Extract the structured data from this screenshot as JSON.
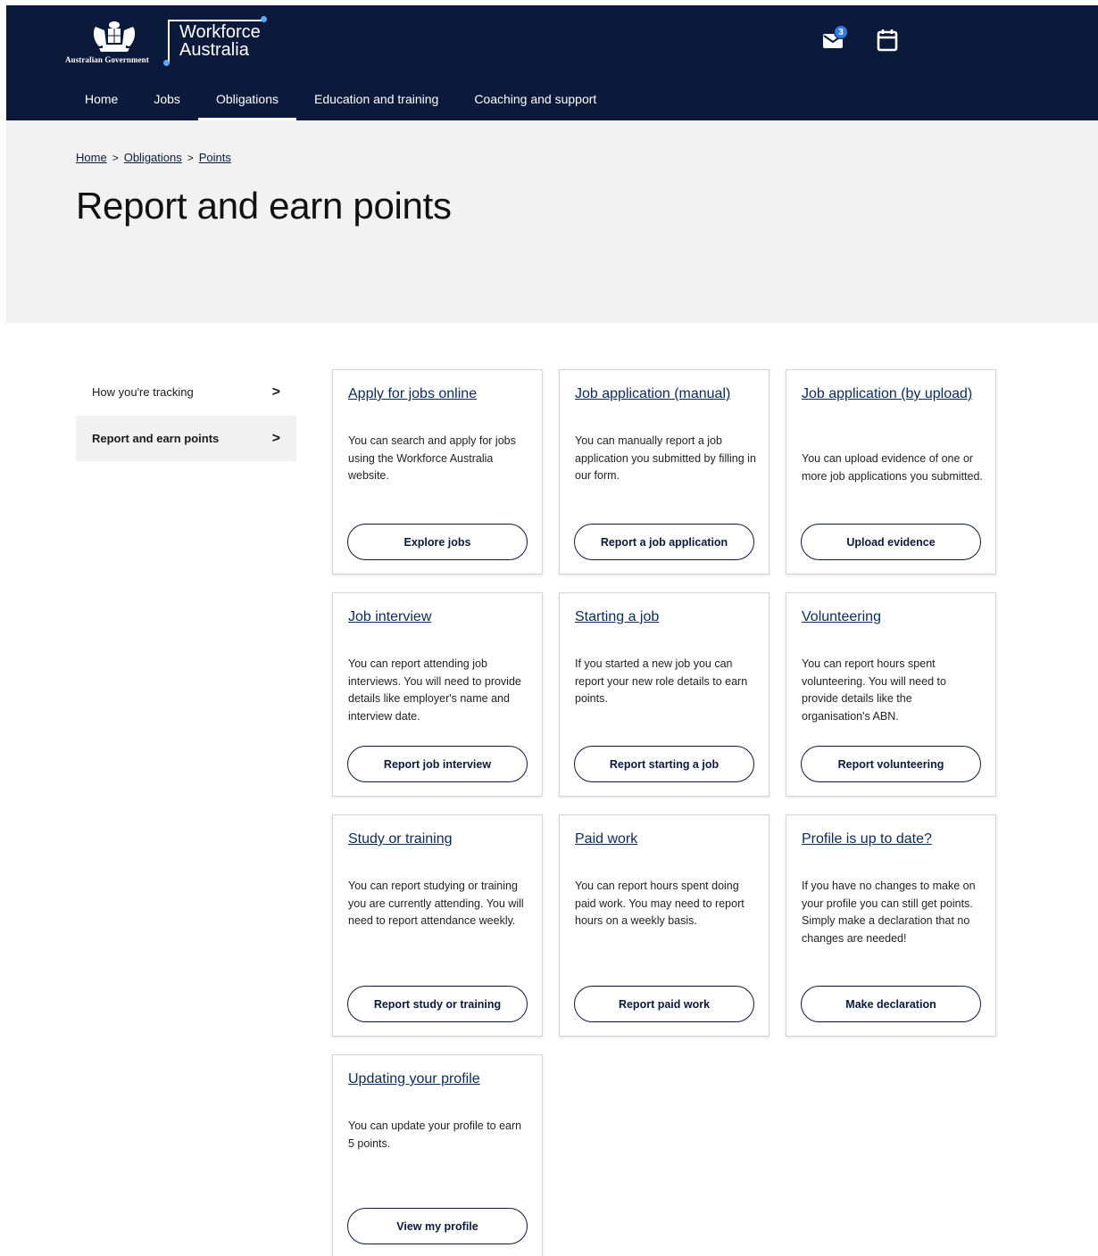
{
  "header": {
    "gov_label": "Australian Government",
    "brand_line1": "Workforce",
    "brand_line2": "Australia",
    "mail_badge": "3",
    "nav": [
      {
        "label": "Home"
      },
      {
        "label": "Jobs"
      },
      {
        "label": "Obligations",
        "active": true
      },
      {
        "label": "Education and training"
      },
      {
        "label": "Coaching and support"
      }
    ]
  },
  "breadcrumb": {
    "items": [
      "Home",
      "Obligations",
      "Points"
    ],
    "separator": ">"
  },
  "page_title": "Report and earn points",
  "sidemenu": {
    "items": [
      {
        "label": "How you're tracking",
        "active": false
      },
      {
        "label": "Report and earn points",
        "active": true
      }
    ],
    "chevron": ">"
  },
  "cards": [
    {
      "title": "Apply for jobs online",
      "desc": "You can search and apply for jobs using the Workforce Australia website.",
      "button": "Explore jobs"
    },
    {
      "title": "Job application (manual)",
      "desc": "You can manually report a job application you submitted by filling in our form.",
      "button": "Report a job application"
    },
    {
      "title": "Job application (by upload)",
      "desc": "You can upload evidence of one or more job applications you submitted.",
      "button": "Upload evidence"
    },
    {
      "title": "Job interview",
      "desc": "You can report attending job interviews. You will need to provide details like employer's name and interview date.",
      "button": "Report job interview"
    },
    {
      "title": "Starting a job",
      "desc": "If you started a new job you can report your new role details to earn points.",
      "button": "Report starting a job"
    },
    {
      "title": "Volunteering",
      "desc": "You can report hours spent volunteering. You will need to provide details like the organisation's ABN.",
      "button": "Report volunteering"
    },
    {
      "title": "Study or training",
      "desc": "You can report studying or training you are currently attending. You will need to report attendance weekly.",
      "button": "Report study or training"
    },
    {
      "title": "Paid work",
      "desc": "You can report hours spent doing paid work. You may need to report hours on a weekly basis.",
      "button": "Report paid work"
    },
    {
      "title": "Profile is up to date?",
      "desc": "If you have no changes to make on your profile you can still get points. Simply make a declaration that no changes are needed!",
      "button": "Make declaration"
    },
    {
      "title": "Updating your profile",
      "desc": "You can update your profile to earn 5 points.",
      "button": "View my profile"
    }
  ],
  "colors": {
    "header_bg": "#0b1a3a",
    "hero_bg": "#f2f2f2",
    "link": "#0b2a57",
    "badge": "#2f7ae5"
  },
  "icons": {
    "mail": "mail-icon",
    "calendar": "calendar-icon",
    "crest": "coat-of-arms-icon"
  }
}
